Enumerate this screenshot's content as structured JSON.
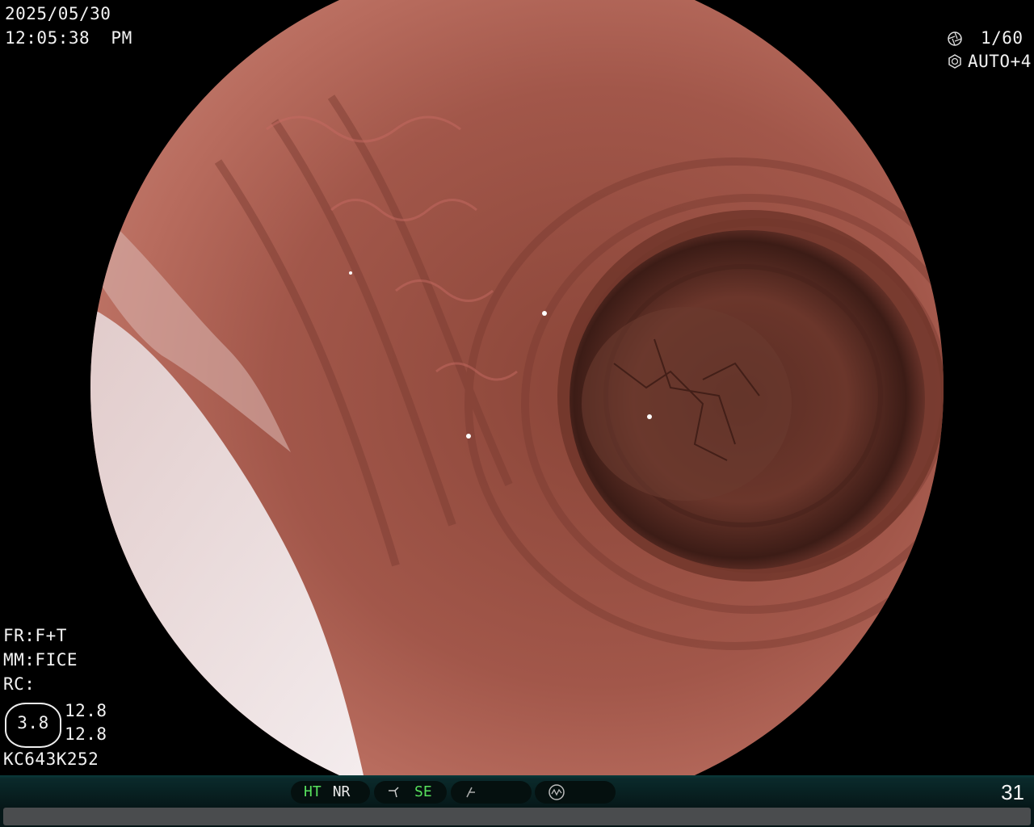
{
  "header": {
    "date": "2025/05/30",
    "time": "12:05:38  PM"
  },
  "camera": {
    "shutter": "1/60",
    "iris": "AUTO+4",
    "shutter_icon": "aperture-icon",
    "iris_icon": "iris-icon"
  },
  "settings": {
    "fr": "FR:F+T",
    "mm": "MM:FICE",
    "rc": "RC:"
  },
  "zoom": {
    "value": "3.8",
    "line1": "12.8",
    "line2": "12.8"
  },
  "scope_id": "KC643K252",
  "status_bar": {
    "ht": "HT",
    "nr": "NR",
    "se": "SE",
    "frame_number": "31",
    "active_color": "#57e05c"
  }
}
